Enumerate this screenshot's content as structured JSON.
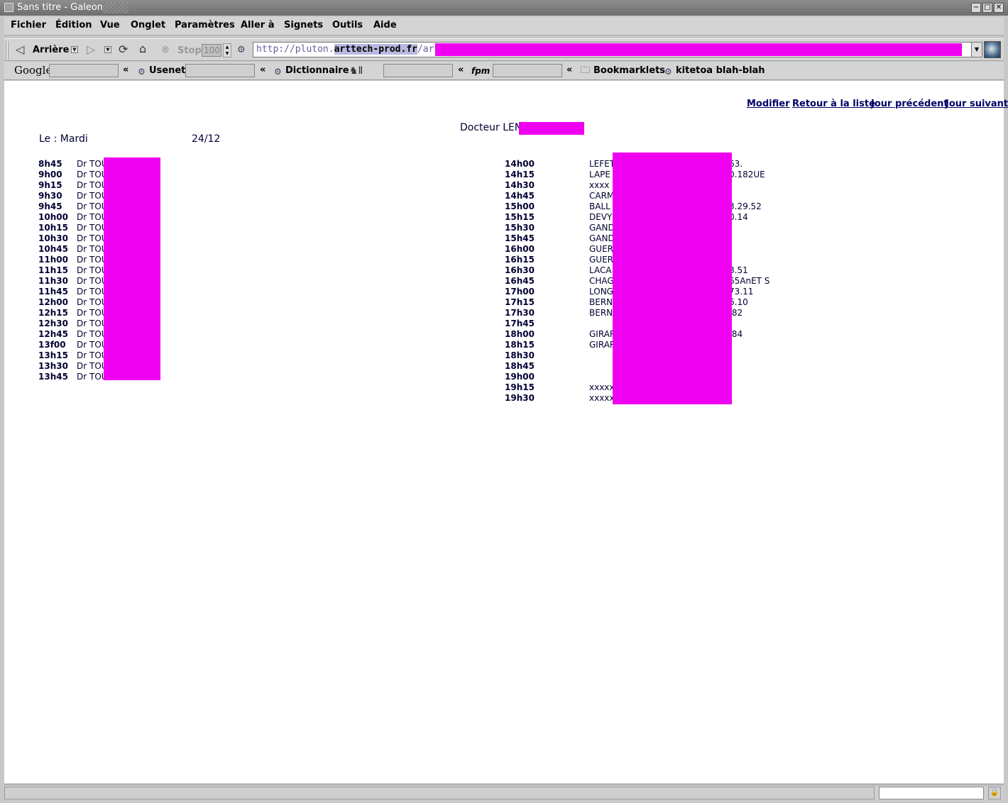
{
  "window": {
    "title": "Sans titre - Galeon",
    "btn_min": "−",
    "btn_max": "□",
    "btn_close": "✕"
  },
  "menu": [
    "Fichier",
    "Édition",
    "Vue",
    "Onglet",
    "Paramètres",
    "Aller à",
    "Signets",
    "Outils",
    "Aide"
  ],
  "toolbar": {
    "back_label": "Arrière",
    "stop_label": "Stop",
    "zoom_value": "100",
    "url_prefix": "http://pluton.",
    "url_highlight": "arttech-prod.fr",
    "url_suffix": "/arttech/"
  },
  "bookmarks": {
    "google_label": "Google",
    "usenet_label": "Usenet",
    "dictionnaire_label": "Dictionnaire",
    "fpm_label": "fpm",
    "bookmarklets_label": "Bookmarklets",
    "kitetoa_label": "kitetoa blah-blah",
    "chevron": "«"
  },
  "page": {
    "links": [
      "Modifier",
      "Retour à la liste",
      "Jour précédent",
      "Jour suivant"
    ],
    "doctor": "Docteur LEN",
    "day_label": "Le : Mardi",
    "date": "24/12"
  },
  "morning": [
    {
      "time": "8h45",
      "name": "Dr TOU"
    },
    {
      "time": "9h00",
      "name": "Dr TOU"
    },
    {
      "time": "9h15",
      "name": "Dr TOU"
    },
    {
      "time": "9h30",
      "name": "Dr TOU"
    },
    {
      "time": "9h45",
      "name": "Dr TOU"
    },
    {
      "time": "10h00",
      "name": "Dr TOU"
    },
    {
      "time": "10h15",
      "name": "Dr TOU"
    },
    {
      "time": "10h30",
      "name": "Dr TOU"
    },
    {
      "time": "10h45",
      "name": "Dr TOU"
    },
    {
      "time": "11h00",
      "name": "Dr TOU"
    },
    {
      "time": "11h15",
      "name": "Dr TOU"
    },
    {
      "time": "11h30",
      "name": "Dr TOU"
    },
    {
      "time": "11h45",
      "name": "Dr TOU"
    },
    {
      "time": "12h00",
      "name": "Dr TOU"
    },
    {
      "time": "12h15",
      "name": "Dr TOU"
    },
    {
      "time": "12h30",
      "name": "Dr TOU"
    },
    {
      "time": "12h45",
      "name": "Dr TOU"
    },
    {
      "time": "13f00",
      "name": "Dr TOU"
    },
    {
      "time": "13h15",
      "name": "Dr TOU"
    },
    {
      "time": "13h30",
      "name": "Dr TOU"
    },
    {
      "time": "13h45",
      "name": "Dr TOU"
    }
  ],
  "afternoon": [
    {
      "time": "14h00",
      "name": "LEFET",
      "tail": "63."
    },
    {
      "time": "14h15",
      "name": "LAPE",
      "tail": "0.182UE"
    },
    {
      "time": "14h30",
      "name": "xxxx",
      "tail": ""
    },
    {
      "time": "14h45",
      "name": "CARM",
      "tail": ""
    },
    {
      "time": "15h00",
      "name": "BALL",
      "tail": "3.29.52"
    },
    {
      "time": "15h15",
      "name": "DEVY",
      "tail": "0.14"
    },
    {
      "time": "15h30",
      "name": "GAND",
      "tail": ""
    },
    {
      "time": "15h45",
      "name": "GAND",
      "tail": ""
    },
    {
      "time": "16h00",
      "name": "GUER",
      "tail": ""
    },
    {
      "time": "16h15",
      "name": "GUER",
      "tail": ""
    },
    {
      "time": "16h30",
      "name": "LACA",
      "tail": "8.51"
    },
    {
      "time": "16h45",
      "name": "CHAG",
      "tail": "65AnET S"
    },
    {
      "time": "17h00",
      "name": "LONG",
      "tail": "73.11"
    },
    {
      "time": "17h15",
      "name": "BERN",
      "tail": "6.10"
    },
    {
      "time": "17h30",
      "name": "BERN",
      "tail": ".82"
    },
    {
      "time": "17h45",
      "name": "",
      "tail": ""
    },
    {
      "time": "18h00",
      "name": "GIRAR",
      "tail": ".84"
    },
    {
      "time": "18h15",
      "name": "GIRAR",
      "tail": ""
    },
    {
      "time": "18h30",
      "name": "",
      "tail": ""
    },
    {
      "time": "18h45",
      "name": "",
      "tail": ""
    },
    {
      "time": "19h00",
      "name": "",
      "tail": ""
    },
    {
      "time": "19h15",
      "name": "xxxxx",
      "tail": ""
    },
    {
      "time": "19h30",
      "name": "xxxxx",
      "tail": ""
    }
  ],
  "colors": {
    "redaction": "#f000f0",
    "link": "#000066"
  }
}
